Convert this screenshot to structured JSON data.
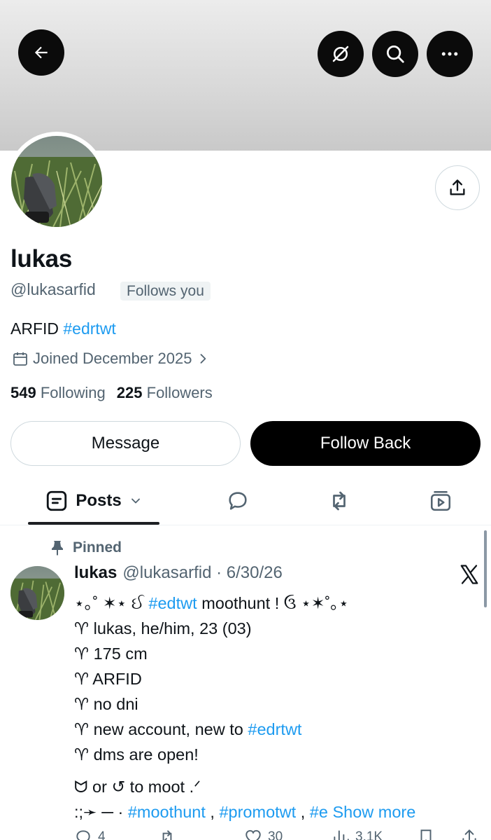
{
  "header": {
    "back_icon": "arrow-left-icon",
    "grok_icon": "grok-icon",
    "search_icon": "search-icon",
    "more_icon": "more-horizontal-icon"
  },
  "profile": {
    "name": "lukas",
    "handle": "@lukasarfid",
    "follows_you": "Follows you",
    "bio_text": "ARFID ",
    "bio_tag": "#edrtwt",
    "joined": "Joined December 2025",
    "following_count": "549",
    "following_label": "Following",
    "followers_count": "225",
    "followers_label": "Followers"
  },
  "buttons": {
    "message": "Message",
    "follow_back": "Follow Back"
  },
  "tabs": {
    "posts_label": "Posts"
  },
  "post": {
    "pinned_label": "Pinned",
    "author": "lukas",
    "meta": "@lukasarfid · 6/30/26",
    "l1_pre": "⋆｡˚ ✶⋆ ઈ ",
    "l1_tag": "#edtwt",
    "l1_post": " moothunt ! ઉ ⋆✶˚｡⋆",
    "l2": "♈ lukas, he/him, 23 (03)",
    "l3": "♈ 175 cm",
    "l4": "♈ ARFID",
    "l5": "♈ no dni",
    "l6_pre": "♈ new account, new to ",
    "l6_tag": "#edrtwt",
    "l7": "♈ dms are open!",
    "l8": "ᗢ  or  ↺  to moot .ᐟ",
    "l9_pre": ":;➛ ─ · ",
    "l9_tag1": "#moothunt",
    "l9_sep1": " , ",
    "l9_tag2": "#promotwt",
    "l9_sep2": " , ",
    "l9_tag3": "#e",
    "show_more": " Show more",
    "replies": "4",
    "likes": "30",
    "views": "3.1K"
  },
  "colors": {
    "accent": "#1d9bf0",
    "text": "#0f1419",
    "muted": "#536471"
  }
}
